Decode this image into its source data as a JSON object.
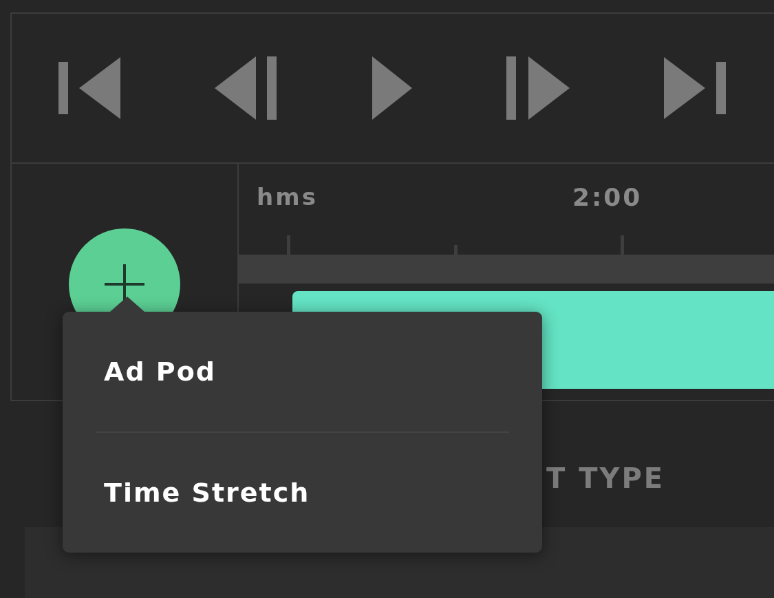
{
  "timeline": {
    "ruler_labels": [
      "hms",
      "2:00"
    ]
  },
  "add_menu": {
    "items": [
      "Ad Pod",
      "Time Stretch"
    ]
  },
  "section_heading": "T TYPE"
}
